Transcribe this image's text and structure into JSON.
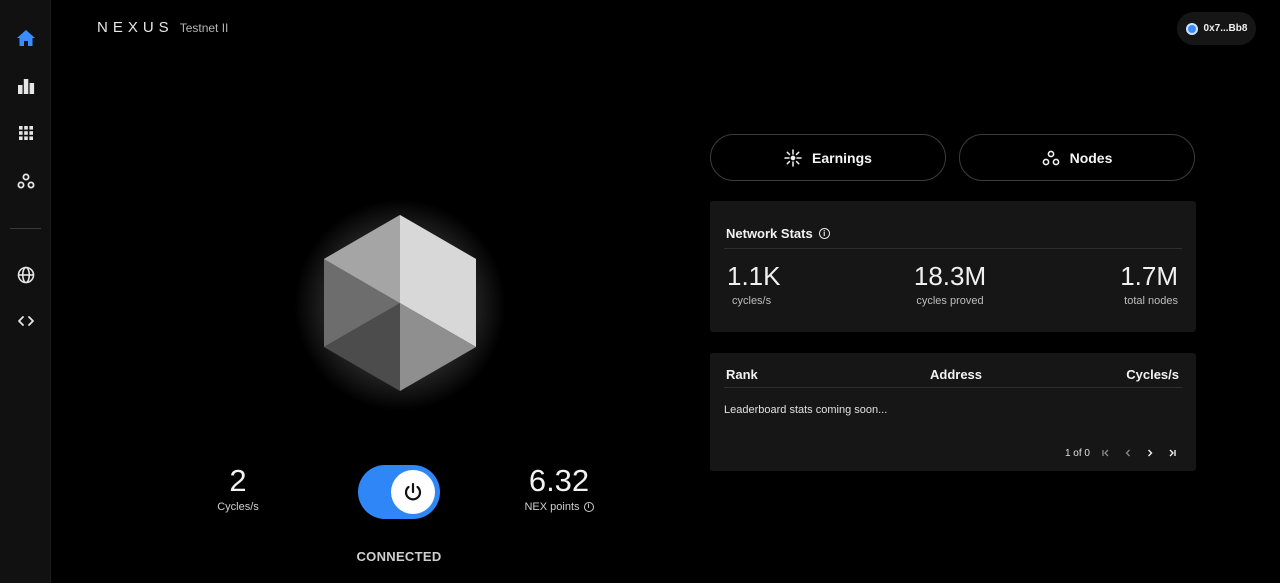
{
  "brand": {
    "logo": "NEXUS",
    "network": "Testnet II"
  },
  "wallet": {
    "address": "0x7...Bb8",
    "accent": "#3a8cff"
  },
  "sidebar": {
    "items": [
      {
        "icon": "home-icon",
        "active": true
      },
      {
        "icon": "bar-chart-icon",
        "active": false
      },
      {
        "icon": "grid-icon",
        "active": false
      },
      {
        "icon": "nodes-icon",
        "active": false
      },
      {
        "icon": "globe-icon",
        "active": false
      },
      {
        "icon": "code-icon",
        "active": false
      }
    ],
    "active_color": "#3a8cff"
  },
  "prover": {
    "cycles_value": "2",
    "cycles_label": "Cycles/s",
    "points_value": "6.32",
    "points_label": "NEX points",
    "status": "CONNECTED",
    "toggle_on": true,
    "toggle_color": "#2f86f6"
  },
  "tabs": {
    "earnings": "Earnings",
    "nodes": "Nodes"
  },
  "network_stats": {
    "title": "Network Stats",
    "stats": [
      {
        "value": "1.1K",
        "label": "cycles/s"
      },
      {
        "value": "18.3M",
        "label": "cycles proved"
      },
      {
        "value": "1.7M",
        "label": "total nodes"
      }
    ]
  },
  "leaderboard": {
    "columns": [
      "Rank",
      "Address",
      "Cycles/s"
    ],
    "empty_message": "Leaderboard stats coming soon...",
    "pagination": "1 of 0"
  }
}
